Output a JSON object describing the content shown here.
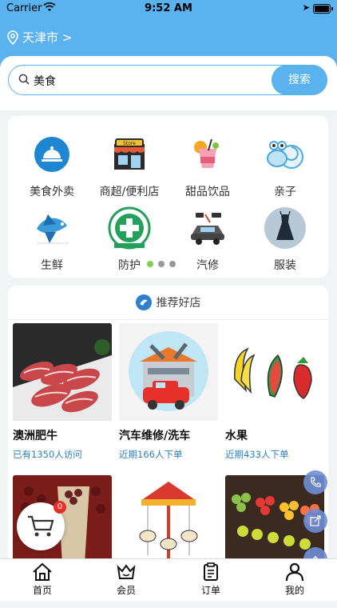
{
  "status": {
    "carrier": "Carrier",
    "time": "9:52 AM"
  },
  "header": {
    "city": "天津市 >"
  },
  "search": {
    "value": "美食",
    "button": "搜索"
  },
  "categories": [
    {
      "label": "美食外卖",
      "icon": "food-delivery-icon"
    },
    {
      "label": "商超/便利店",
      "icon": "store-icon"
    },
    {
      "label": "甜品饮品",
      "icon": "drink-icon"
    },
    {
      "label": "亲子",
      "icon": "kids-icon"
    },
    {
      "label": "生鲜",
      "icon": "fish-icon"
    },
    {
      "label": "防护",
      "icon": "protection-icon"
    },
    {
      "label": "汽修",
      "icon": "car-repair-icon"
    },
    {
      "label": "服装",
      "icon": "dress-icon"
    }
  ],
  "carousel": {
    "pages": 3,
    "active": 1
  },
  "shops": {
    "title": "推荐好店",
    "items": [
      {
        "name": "澳洲肥牛",
        "info": "已有1350人访问"
      },
      {
        "name": "汽车维修/洗车",
        "info": "近期166人下单"
      },
      {
        "name": "水果",
        "info": "近期433人下单"
      }
    ]
  },
  "cart": {
    "count": "0"
  },
  "tabs": [
    {
      "label": "首页",
      "icon": "home-icon"
    },
    {
      "label": "会员",
      "icon": "member-icon"
    },
    {
      "label": "订单",
      "icon": "order-icon"
    },
    {
      "label": "我的",
      "icon": "profile-icon"
    }
  ],
  "colors": {
    "primary": "#5ab2ee",
    "link": "#2c7fbf",
    "badge": "#e8302b",
    "dot_active": "#7bd14b"
  }
}
